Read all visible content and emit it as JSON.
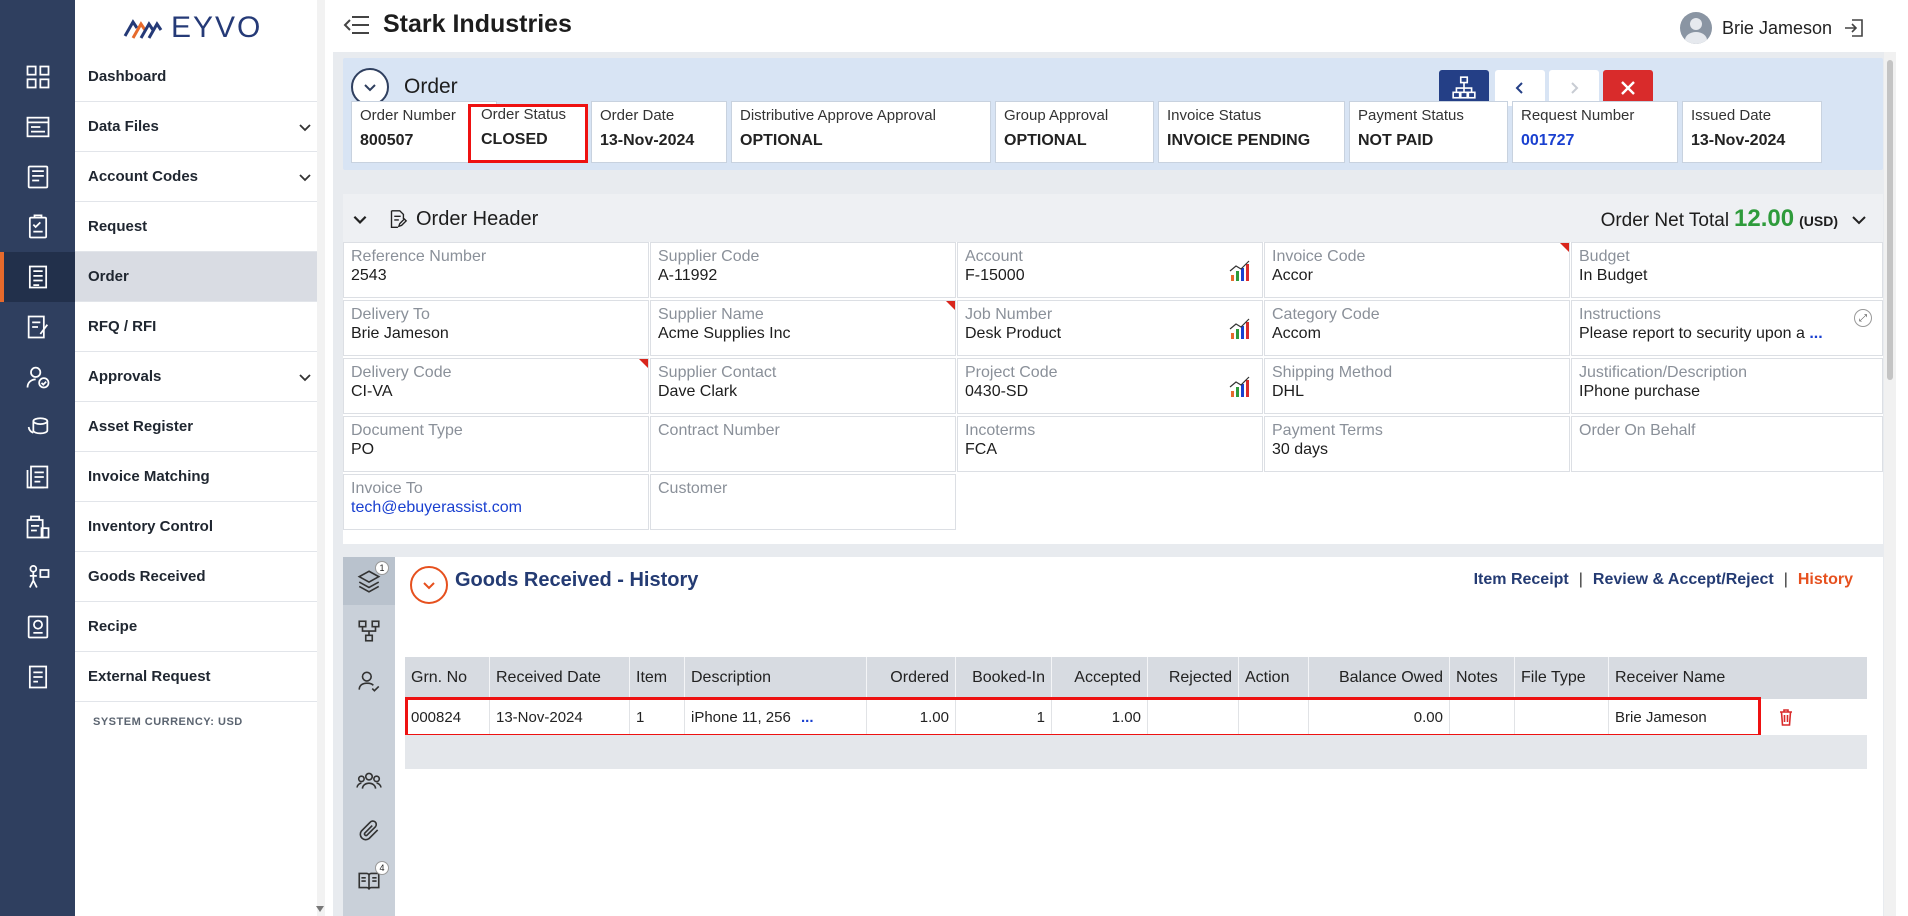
{
  "app": {
    "logo_text": "EYVO",
    "company": "Stark Industries",
    "user_name": "Brie Jameson",
    "system_currency": "SYSTEM CURRENCY: USD"
  },
  "rail_icons": [
    "grid-icon",
    "data-files-icon",
    "account-codes-icon",
    "request-icon",
    "order-icon",
    "rfq-icon",
    "approvals-icon",
    "asset-register-icon",
    "invoice-matching-icon",
    "inventory-control-icon",
    "goods-received-icon",
    "recipe-icon",
    "external-request-icon"
  ],
  "nav": {
    "items": [
      {
        "label": "Dashboard"
      },
      {
        "label": "Data Files"
      },
      {
        "label": "Account Codes"
      },
      {
        "label": "Request"
      },
      {
        "label": "Order"
      },
      {
        "label": "RFQ / RFI"
      },
      {
        "label": "Approvals"
      },
      {
        "label": "Asset Register"
      },
      {
        "label": "Invoice Matching"
      },
      {
        "label": "Inventory Control"
      },
      {
        "label": "Goods Received"
      },
      {
        "label": "Recipe"
      },
      {
        "label": "External Request"
      }
    ]
  },
  "order": {
    "title": "Order",
    "status_boxes": [
      {
        "label": "Order Number",
        "value": "800507"
      },
      {
        "label": "Order Status",
        "value": "CLOSED"
      },
      {
        "label": "Order Date",
        "value": "13-Nov-2024"
      },
      {
        "label": "Distributive Approve Approval",
        "value": "OPTIONAL"
      },
      {
        "label": "Group Approval",
        "value": "OPTIONAL"
      },
      {
        "label": "Invoice Status",
        "value": "INVOICE PENDING"
      },
      {
        "label": "Payment Status",
        "value": "NOT PAID"
      },
      {
        "label": "Request Number",
        "value": "001727"
      },
      {
        "label": "Issued Date",
        "value": "13-Nov-2024"
      }
    ]
  },
  "header": {
    "title": "Order Header",
    "net_total_label": "Order Net Total",
    "net_total_value": "12.00",
    "net_total_currency": "(USD)",
    "fields": [
      {
        "label": "Reference Number",
        "value": "2543"
      },
      {
        "label": "Supplier Code",
        "value": "A-11992"
      },
      {
        "label": "Account",
        "value": "F-15000"
      },
      {
        "label": "Invoice Code",
        "value": "Accor"
      },
      {
        "label": "Budget",
        "value": "In Budget"
      },
      {
        "label": "Delivery To",
        "value": "Brie Jameson"
      },
      {
        "label": "Supplier Name",
        "value": "Acme Supplies Inc"
      },
      {
        "label": "Job Number",
        "value": "Desk Product"
      },
      {
        "label": "Category Code",
        "value": "Accom"
      },
      {
        "label": "Instructions",
        "value": "Please report to security upon a"
      },
      {
        "label": "Delivery Code",
        "value": "CI-VA"
      },
      {
        "label": "Supplier Contact",
        "value": "Dave Clark"
      },
      {
        "label": "Project Code",
        "value": "0430-SD"
      },
      {
        "label": "Shipping Method",
        "value": "DHL"
      },
      {
        "label": "Justification/Description",
        "value": "IPhone purchase"
      },
      {
        "label": "Document Type",
        "value": "PO"
      },
      {
        "label": "Contract Number",
        "value": ""
      },
      {
        "label": "Incoterms",
        "value": "FCA"
      },
      {
        "label": "Payment Terms",
        "value": "30 days"
      },
      {
        "label": "Order On Behalf",
        "value": ""
      },
      {
        "label": "Invoice To",
        "value": "tech@ebuyerassist.com"
      },
      {
        "label": "Customer",
        "value": ""
      }
    ],
    "more_indicator": "..."
  },
  "goods_received": {
    "title": "Goods Received - History",
    "links": {
      "item_receipt": "Item Receipt",
      "review": "Review & Accept/Reject",
      "history": "History",
      "sep": "|"
    },
    "side_badges": {
      "layers": "1",
      "book": "4"
    },
    "columns": [
      "Grn. No",
      "Received Date",
      "Item",
      "Description",
      "Ordered",
      "Booked-In",
      "Accepted",
      "Rejected",
      "Action",
      "Balance Owed",
      "Notes",
      "File Type",
      "Receiver Name"
    ],
    "rows": [
      {
        "grn": "000824",
        "date": "13-Nov-2024",
        "item": "1",
        "description": "iPhone 11, 256",
        "more": "...",
        "ordered": "1.00",
        "booked_in": "1",
        "accepted": "1.00",
        "rejected": "",
        "action": "",
        "balance": "0.00",
        "notes": "",
        "file_type": "",
        "receiver": "Brie Jameson"
      }
    ]
  },
  "colors": {
    "rail": "#2f3f5f",
    "highlight": "#e11111",
    "net_total": "#2e9b3b",
    "link_blue": "#1a40d0",
    "history_orange": "#e6501e"
  }
}
